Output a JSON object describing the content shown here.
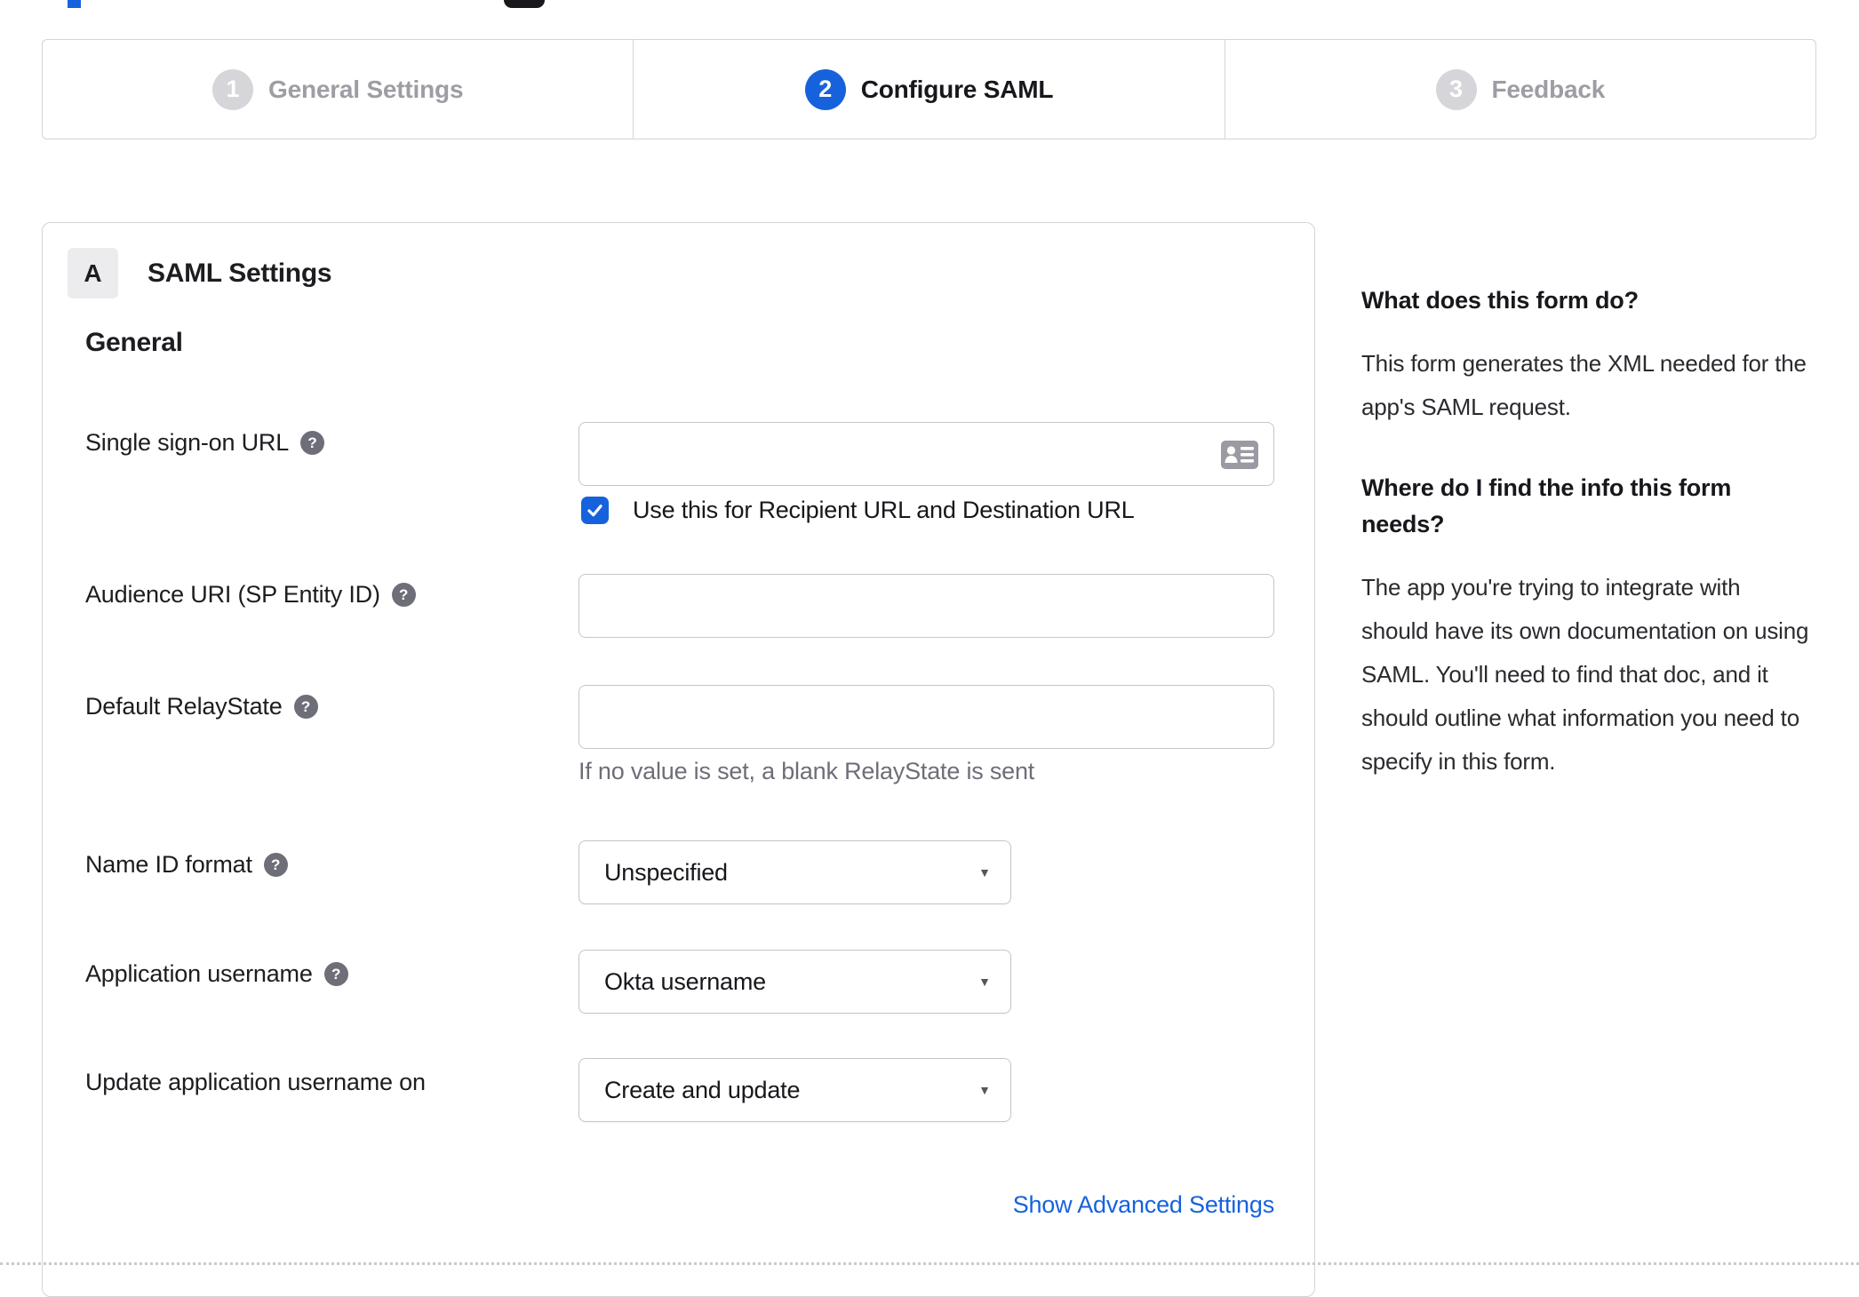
{
  "colors": {
    "accent_blue": "#1662dd",
    "panel_border": "#d4d4d9",
    "text_dark": "#1d1d21",
    "inactive_step_gray": "#9d9da5",
    "hint_gray": "#6e6e78"
  },
  "stepper": {
    "steps": [
      {
        "number": "1",
        "label": "General Settings",
        "state": "inactive"
      },
      {
        "number": "2",
        "label": "Configure SAML",
        "state": "active"
      },
      {
        "number": "3",
        "label": "Feedback",
        "state": "inactive"
      }
    ]
  },
  "panel": {
    "badge": "A",
    "title": "SAML Settings",
    "section_heading": "General",
    "fields": {
      "sso": {
        "label": "Single sign-on URL",
        "value": "",
        "checkbox_checked": true,
        "checkbox_label": "Use this for Recipient URL and Destination URL"
      },
      "audience": {
        "label": "Audience URI (SP Entity ID)",
        "value": ""
      },
      "relay": {
        "label": "Default RelayState",
        "value": "",
        "hint": "If no value is set, a blank RelayState is sent"
      },
      "nameid": {
        "label": "Name ID format",
        "value": "Unspecified"
      },
      "appuser": {
        "label": "Application username",
        "value": "Okta username"
      },
      "updateuser": {
        "label": "Update application username on",
        "value": "Create and update"
      }
    },
    "advanced_link": "Show Advanced Settings"
  },
  "sidebar": {
    "sections": [
      {
        "heading": "What does this form do?",
        "body": "This form generates the XML needed for the app's SAML request."
      },
      {
        "heading": "Where do I find the info this form needs?",
        "body": "The app you're trying to integrate with should have its own documentation on using SAML. You'll need to find that doc, and it should outline what information you need to specify in this form."
      }
    ]
  },
  "icons": {
    "help": "?",
    "dropdown_arrow": "▼"
  }
}
